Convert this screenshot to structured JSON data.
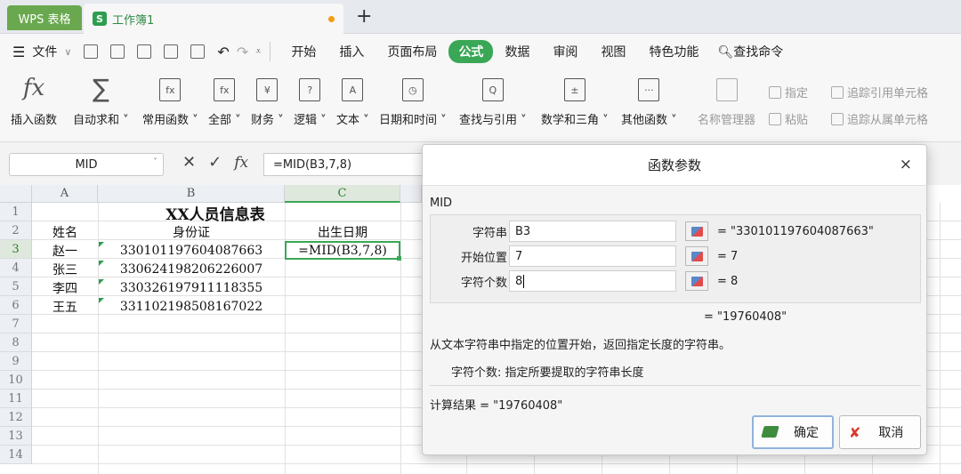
{
  "titlebar": {
    "app_name": "WPS 表格",
    "doc_tab": "工作簿1",
    "doc_icon": "S"
  },
  "menubar": {
    "file": "文件",
    "items": [
      "开始",
      "插入",
      "页面布局",
      "公式",
      "数据",
      "审阅",
      "视图",
      "特色功能"
    ],
    "active": "公式",
    "search": "查找命令"
  },
  "ribbon": {
    "buttons": [
      "插入函数",
      "自动求和",
      "常用函数",
      "全部",
      "财务",
      "逻辑",
      "文本",
      "日期和时间",
      "查找与引用",
      "数学和三角",
      "其他函数",
      "名称管理器"
    ],
    "small": [
      "指定",
      "粘贴",
      "追踪引用单元格",
      "追踪从属单元格"
    ]
  },
  "formulabar": {
    "name_box": "MID",
    "formula": "=MID(B3,7,8)"
  },
  "grid": {
    "columns": [
      "A",
      "B",
      "C"
    ],
    "rows": [
      "1",
      "2",
      "3",
      "4",
      "5",
      "6",
      "7",
      "8",
      "9",
      "10",
      "11",
      "12",
      "13",
      "14"
    ],
    "title": "XX人员信息表",
    "headers": [
      "姓名",
      "身份证",
      "出生日期"
    ],
    "data": [
      {
        "name": "赵一",
        "id": "330101197604087663",
        "birth": "=MID(B3,7,8)"
      },
      {
        "name": "张三",
        "id": "330624198206226007",
        "birth": ""
      },
      {
        "name": "李四",
        "id": "330326197911118355",
        "birth": ""
      },
      {
        "name": "王五",
        "id": "331102198508167022",
        "birth": ""
      }
    ]
  },
  "dialog": {
    "title": "函数参数",
    "close": "×",
    "function": "MID",
    "args": [
      {
        "label": "字符串",
        "value": "B3",
        "result": "= \"330101197604087663\""
      },
      {
        "label": "开始位置",
        "value": "7",
        "result": "= 7"
      },
      {
        "label": "字符个数",
        "value": "8",
        "result": "= 8"
      }
    ],
    "overall_result": "= \"19760408\"",
    "description": "从文本字符串中指定的位置开始，返回指定长度的字符串。",
    "param_help": "字符个数:  指定所要提取的字符串长度",
    "calc_result": "计算结果 = \"19760408\"",
    "ok": "确定",
    "cancel": "取消"
  }
}
